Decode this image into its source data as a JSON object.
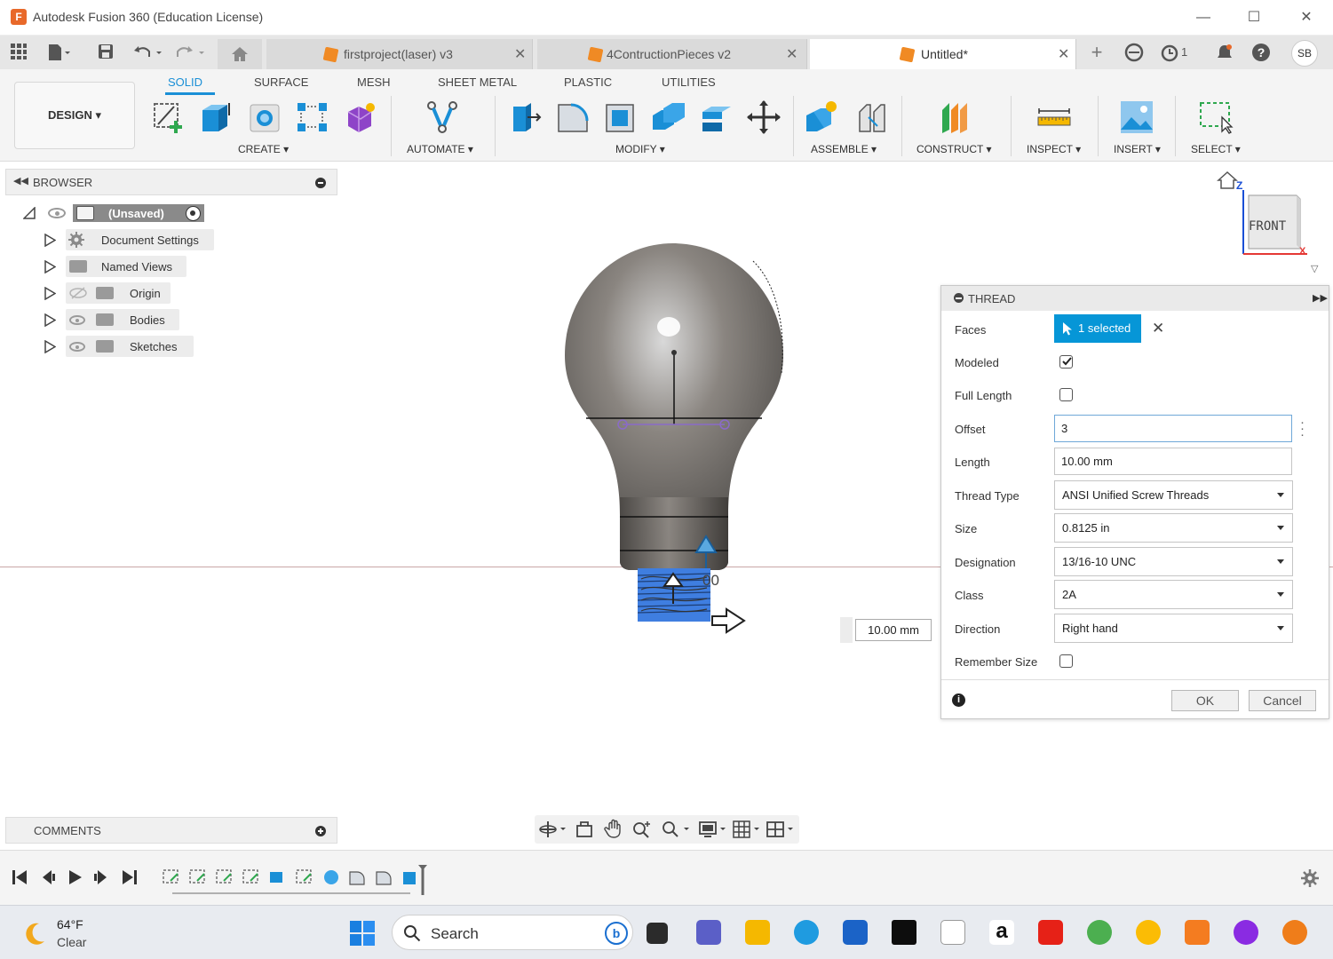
{
  "window": {
    "title": "Autodesk Fusion 360 (Education License)",
    "app_letter": "F"
  },
  "tabs": [
    {
      "label": "firstproject(laser) v3"
    },
    {
      "label": "4ContructionPieces v2"
    },
    {
      "label": "Untitled*"
    }
  ],
  "tabbar": {
    "clock_count": "1",
    "user_initials": "SB"
  },
  "ribbon": {
    "workspace": "DESIGN",
    "tabs": [
      "SOLID",
      "SURFACE",
      "MESH",
      "SHEET METAL",
      "PLASTIC",
      "UTILITIES"
    ],
    "groups": [
      "CREATE",
      "AUTOMATE",
      "MODIFY",
      "ASSEMBLE",
      "CONSTRUCT",
      "INSPECT",
      "INSERT",
      "SELECT"
    ]
  },
  "browser": {
    "title": "BROWSER",
    "root": "(Unsaved)",
    "items": [
      "Document Settings",
      "Named Views",
      "Origin",
      "Bodies",
      "Sketches"
    ]
  },
  "comments": {
    "title": "COMMENTS"
  },
  "viewcube": {
    "face": "FRONT",
    "axis_z": "Z",
    "axis_x": "X"
  },
  "viewport": {
    "dimension_value": "10.00 mm",
    "overlay_text": "00"
  },
  "thread": {
    "title": "THREAD",
    "faces_label": "Faces",
    "faces_value": "1 selected",
    "modeled_label": "Modeled",
    "modeled_checked": true,
    "full_length_label": "Full Length",
    "offset_label": "Offset",
    "offset_value": "3",
    "length_label": "Length",
    "length_value": "10.00 mm",
    "thread_type_label": "Thread Type",
    "thread_type_value": "ANSI Unified Screw Threads",
    "size_label": "Size",
    "size_value": "0.8125 in",
    "designation_label": "Designation",
    "designation_value": "13/16-10 UNC",
    "class_label": "Class",
    "class_value": "2A",
    "direction_label": "Direction",
    "direction_value": "Right hand",
    "remember_label": "Remember Size",
    "ok_label": "OK",
    "cancel_label": "Cancel"
  },
  "taskbar": {
    "temperature": "64°F",
    "condition": "Clear",
    "search_label": "Search"
  },
  "colors": {
    "accent": "#1a8fd6",
    "selection": "#0696d7",
    "brand": "#e8692a"
  }
}
